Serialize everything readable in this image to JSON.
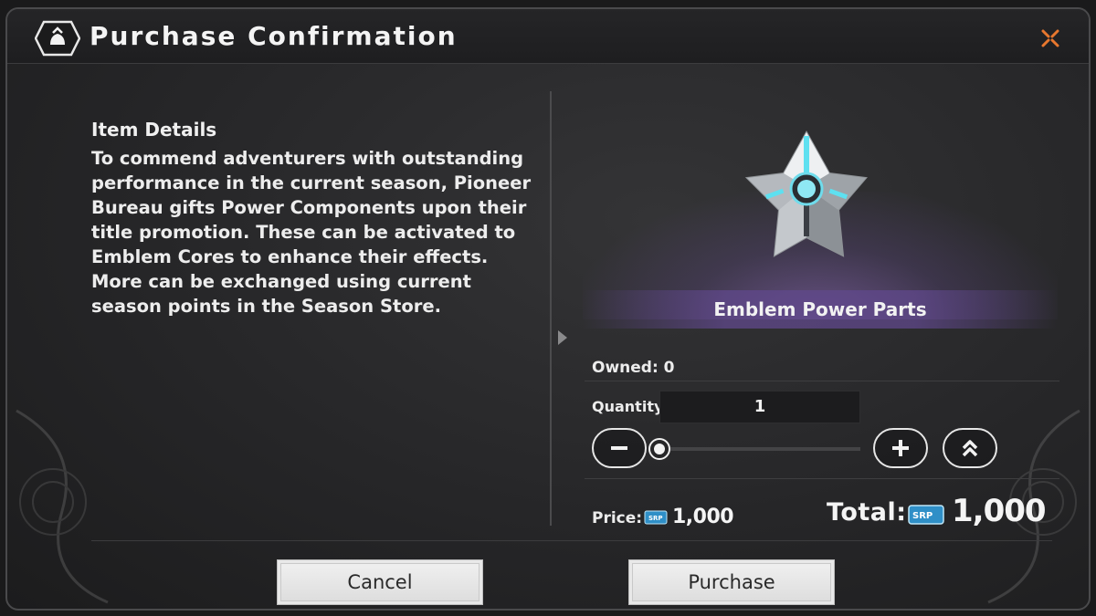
{
  "dialog": {
    "title": "Purchase Confirmation",
    "close_icon": "close-x-icon",
    "header_icon": "bag-icon"
  },
  "details": {
    "heading": "Item Details",
    "text": "To commend adventurers with outstanding performance in the current season, Pioneer Bureau gifts Power Components upon their title promotion. These can be activated to Emblem Cores to enhance their effects. More can be exchanged using current season points in the Season Store."
  },
  "item": {
    "name": "Emblem Power Parts",
    "icon": "ghost-shell-item-icon"
  },
  "inventory": {
    "owned": "Owned: 0"
  },
  "quantity": {
    "label": "Quantity",
    "value": "1",
    "slider_fraction": 0
  },
  "price": {
    "label": "Price:",
    "currency_icon": "SRP",
    "value": "1,000"
  },
  "total": {
    "label": "Total:",
    "currency_icon": "SRP",
    "value": "1,000"
  },
  "actions": {
    "cancel_label": "Cancel",
    "purchase_label": "Purchase"
  },
  "colors": {
    "accent_close": "#e8772e",
    "item_glow": "#7a5ab0",
    "currency": "#3aa6d8"
  }
}
